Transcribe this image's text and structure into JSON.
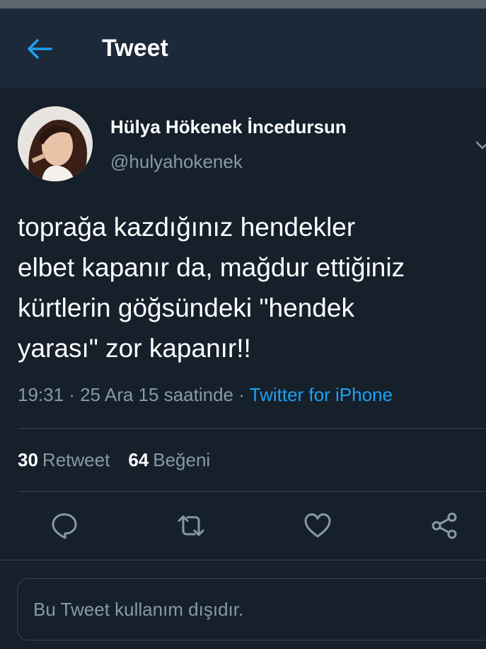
{
  "header": {
    "title": "Tweet"
  },
  "tweet": {
    "author": {
      "display_name": "Hülya Hökenek İncedursun",
      "handle": "@hulyahokenek"
    },
    "text": "toprağa kazdığınız hendekler\nelbet kapanır da, mağdur ettiğiniz\nkürtlerin göğsündeki \"hendek\nyarası\" zor kapanır!!",
    "timestamp": "19:31 · 25 Ara 15 saatinde · ",
    "source": "Twitter for iPhone"
  },
  "stats": {
    "retweets_count": "30",
    "retweets_label": "Retweet",
    "likes_count": "64",
    "likes_label": "Beğeni"
  },
  "notice": {
    "text": "Bu Tweet kullanım dışıdır."
  },
  "colors": {
    "background": "#15202b",
    "header": "#1c2938",
    "accent": "#1da1f2",
    "secondary_text": "#8899a6"
  }
}
